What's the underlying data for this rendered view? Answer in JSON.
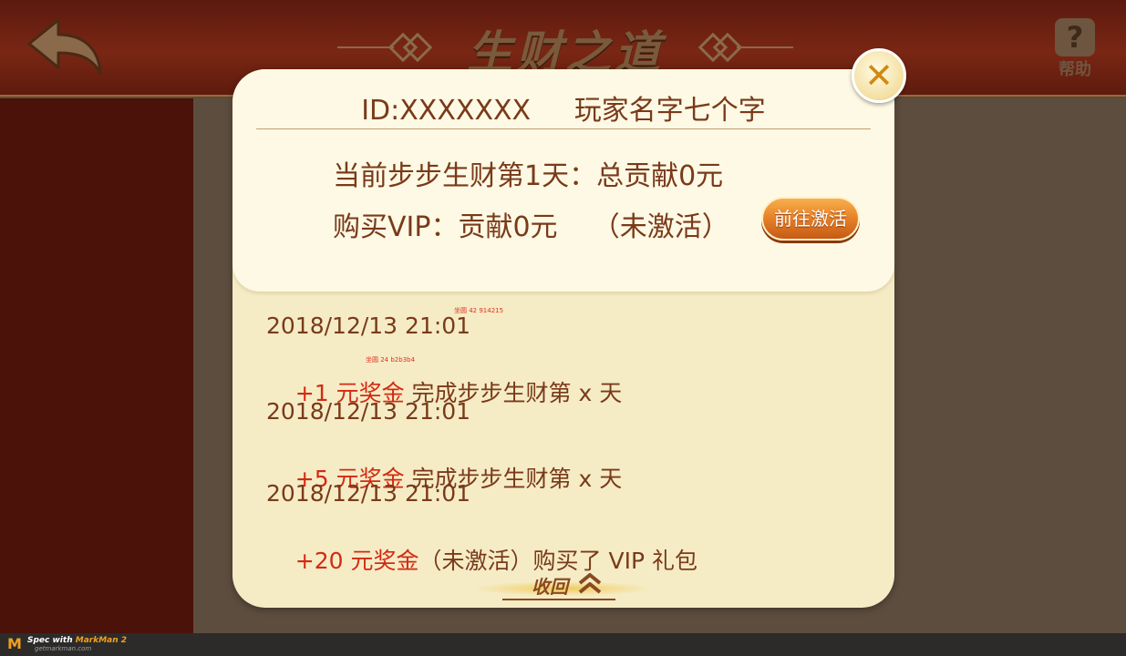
{
  "header": {
    "title": "生财之道",
    "help_label": "帮助",
    "help_symbol": "?"
  },
  "dialog": {
    "id_line": "ID:XXXXXXX     玩家名字七个字",
    "progress_line": "当前步步生财第1天：总贡献0元",
    "vip_line": "购买VIP：贡献0元    （未激活）",
    "activate_button": "前往激活",
    "close_symbol": "✕",
    "entries": [
      {
        "date": "2018/12/13 21:01",
        "amount": "+1 元奖金",
        "desc": " 完成步步生财第 x 天"
      },
      {
        "date": "2018/12/13 21:01",
        "amount": "+5 元奖金",
        "desc": " 完成步步生财第 x 天"
      },
      {
        "date": "2018/12/13 21:01",
        "amount": "+20 元奖金",
        "desc": "（未激活）购买了 VIP 礼包"
      }
    ],
    "annotations": [
      "坐圆 42 914215",
      "坐圆 24 b2b3b4"
    ],
    "collapse_label": "收回"
  },
  "footer": {
    "brand_prefix": "Spec with ",
    "brand_name": "MarkMan 2",
    "url": "getmarkman.com"
  },
  "colors": {
    "header_bg": "#7a2614",
    "dialog_bg": "#f5ecc6",
    "text_brown": "#7a3a1a",
    "accent_red": "#d42a12",
    "button_orange": "#e8842a"
  }
}
